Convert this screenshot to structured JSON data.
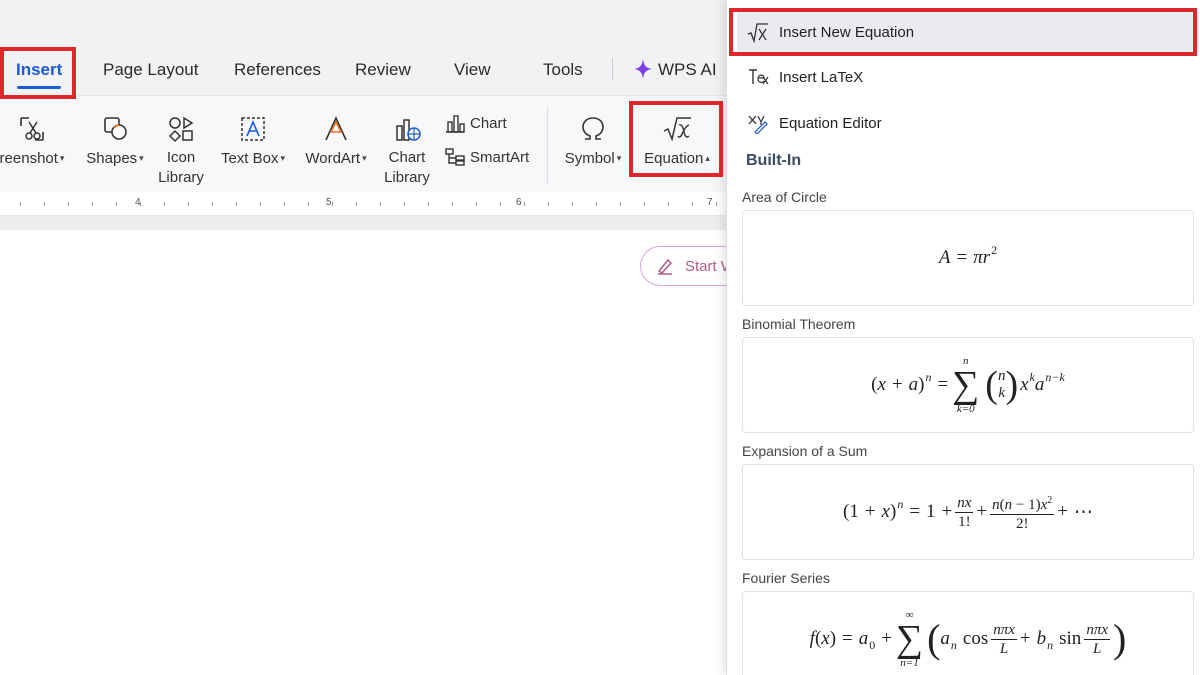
{
  "tabs": {
    "insert": "Insert",
    "page_layout": "Page Layout",
    "references": "References",
    "review": "Review",
    "view": "View",
    "tools": "Tools",
    "wps_ai": "WPS AI"
  },
  "ribbon": {
    "screenshot": "reenshot",
    "shapes": "Shapes",
    "icon_library_1": "Icon",
    "icon_library_2": "Library",
    "text_box": "Text Box",
    "wordart": "WordArt",
    "chart_library_1": "Chart",
    "chart_library_2": "Library",
    "chart": "Chart",
    "smartart": "SmartArt",
    "symbol": "Symbol",
    "equation": "Equation"
  },
  "ruler": {
    "marks": [
      "4",
      "5",
      "6",
      "7"
    ]
  },
  "document": {
    "start_button": "Start W"
  },
  "panel": {
    "insert_new_equation": "Insert New Equation",
    "insert_latex": "Insert LaTeX",
    "equation_editor": "Equation Editor",
    "built_in": "Built-In",
    "equations": [
      {
        "name": "Area of Circle"
      },
      {
        "name": "Binomial Theorem"
      },
      {
        "name": "Expansion of a Sum"
      },
      {
        "name": "Fourier Series"
      }
    ]
  },
  "colors": {
    "accent_blue": "#1d5bd6",
    "highlight_red": "#e0262b",
    "wps_ai_purple": "#7b3fe4"
  }
}
